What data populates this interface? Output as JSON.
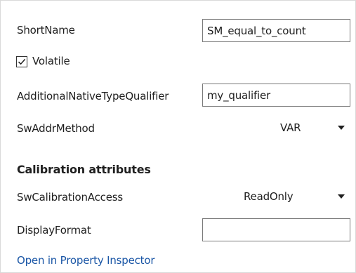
{
  "fields": {
    "short_name": {
      "label": "ShortName",
      "value": "SM_equal_to_count"
    },
    "volatile": {
      "label": "Volatile",
      "checked": true
    },
    "additional_native_type_qualifier": {
      "label": "AdditionalNativeTypeQualifier",
      "value": "my_qualifier"
    },
    "sw_addr_method": {
      "label": "SwAddrMethod",
      "selected": "VAR"
    }
  },
  "calibration": {
    "heading": "Calibration attributes",
    "sw_calibration_access": {
      "label": "SwCalibrationAccess",
      "selected": "ReadOnly"
    },
    "display_format": {
      "label": "DisplayFormat",
      "value": ""
    }
  },
  "links": {
    "open_property_inspector": "Open in Property Inspector"
  },
  "colors": {
    "link": "#1a56a6",
    "border": "#7a7a7a"
  },
  "icons": {
    "checkmark": "checkmark-icon",
    "dropdown": "chevron-down-icon"
  }
}
